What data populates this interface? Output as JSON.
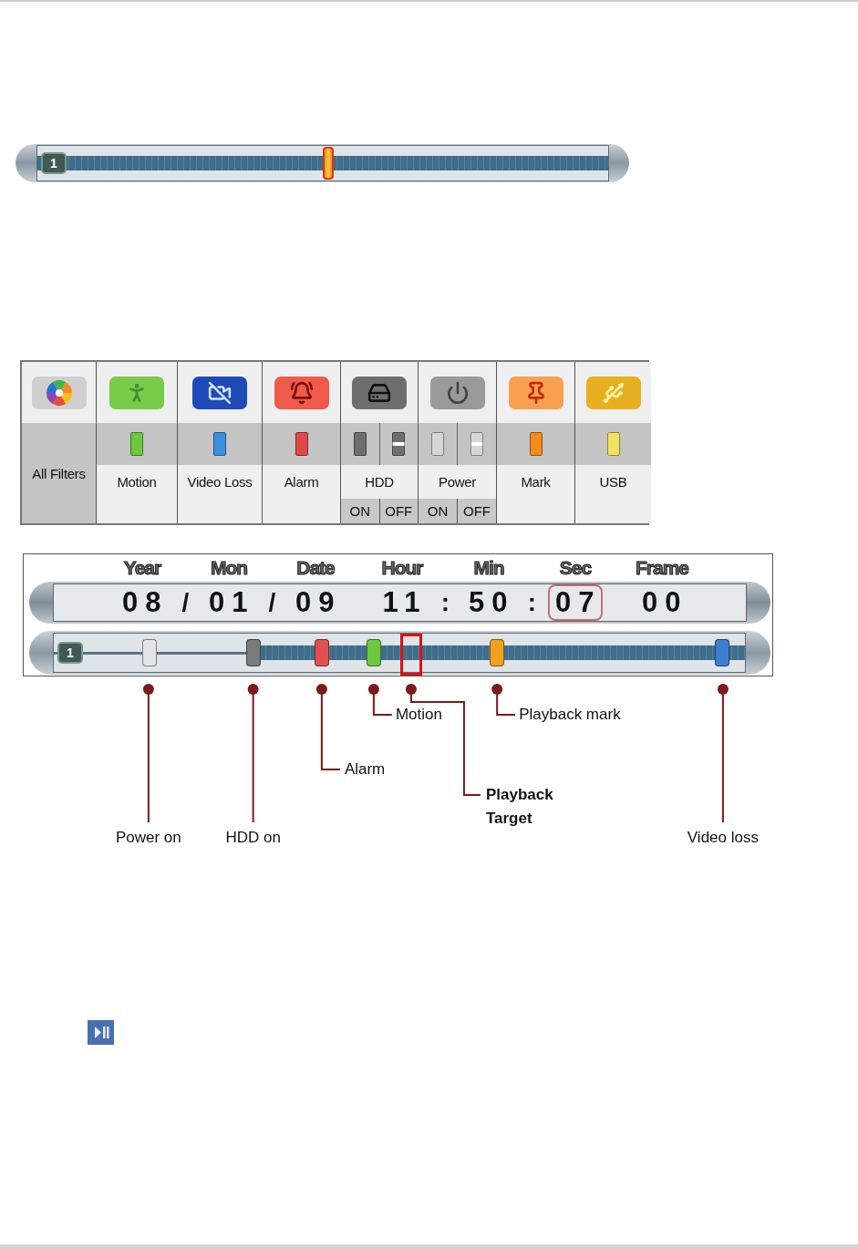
{
  "top_timeline": {
    "channel": "1",
    "playhead": {
      "level": 0.51
    }
  },
  "filters": [
    {
      "kind": "all",
      "label": "All Filters"
    },
    {
      "kind": "motion",
      "label": "Motion",
      "color": "#6cc83c"
    },
    {
      "kind": "video-loss",
      "label": "Video Loss",
      "color": "#3d8fe0"
    },
    {
      "kind": "alarm",
      "label": "Alarm",
      "color": "#e04848"
    },
    {
      "kind": "hdd",
      "label": "HDD",
      "color": "#6e6e6e",
      "options": [
        {
          "label": "ON",
          "kind": "on"
        },
        {
          "label": "OFF",
          "kind": "off"
        }
      ]
    },
    {
      "kind": "power",
      "label": "Power",
      "color": "#d6d6d6",
      "options": [
        {
          "label": "ON",
          "kind": "on"
        },
        {
          "label": "OFF",
          "kind": "off"
        }
      ]
    },
    {
      "kind": "mark",
      "label": "Mark",
      "color": "#f28a1c"
    },
    {
      "kind": "usb",
      "label": "USB",
      "color": "#f2e060"
    }
  ],
  "time_panel": {
    "fields": [
      {
        "label": "Year",
        "value": "08",
        "separator": "/",
        "selected": false
      },
      {
        "label": "Mon",
        "value": "01",
        "separator": "/",
        "selected": false
      },
      {
        "label": "Date",
        "value": "09",
        "selected": false
      },
      {
        "label": "Hour",
        "value": "11",
        "separator": ":",
        "selected": false
      },
      {
        "label": "Min",
        "value": "50",
        "separator": ":",
        "selected": false
      },
      {
        "label": "Sec",
        "value": "07",
        "selected": true
      },
      {
        "label": "Frame",
        "value": "00",
        "selected": false
      }
    ],
    "timeline": {
      "channel": "1",
      "markers": [
        {
          "kind": "power-on",
          "level": 0.138,
          "label": "Power on",
          "color": "#e4e4e4"
        },
        {
          "kind": "hdd-on",
          "level": 0.289,
          "label": "HDD  on",
          "color": "#7a7a7a"
        },
        {
          "kind": "alarm",
          "level": 0.388,
          "label": "Alarm",
          "color": "#e05050"
        },
        {
          "kind": "motion",
          "level": 0.463,
          "label": "Motion",
          "color": "#6cc83c"
        },
        {
          "kind": "target",
          "level": 0.517,
          "label": "Playback Target"
        },
        {
          "kind": "playback-mark",
          "level": 0.641,
          "label": "Playback mark",
          "color": "#f2a020"
        },
        {
          "kind": "video-loss",
          "level": 0.967,
          "label": "Video loss",
          "color": "#3d7fd0"
        }
      ]
    }
  }
}
